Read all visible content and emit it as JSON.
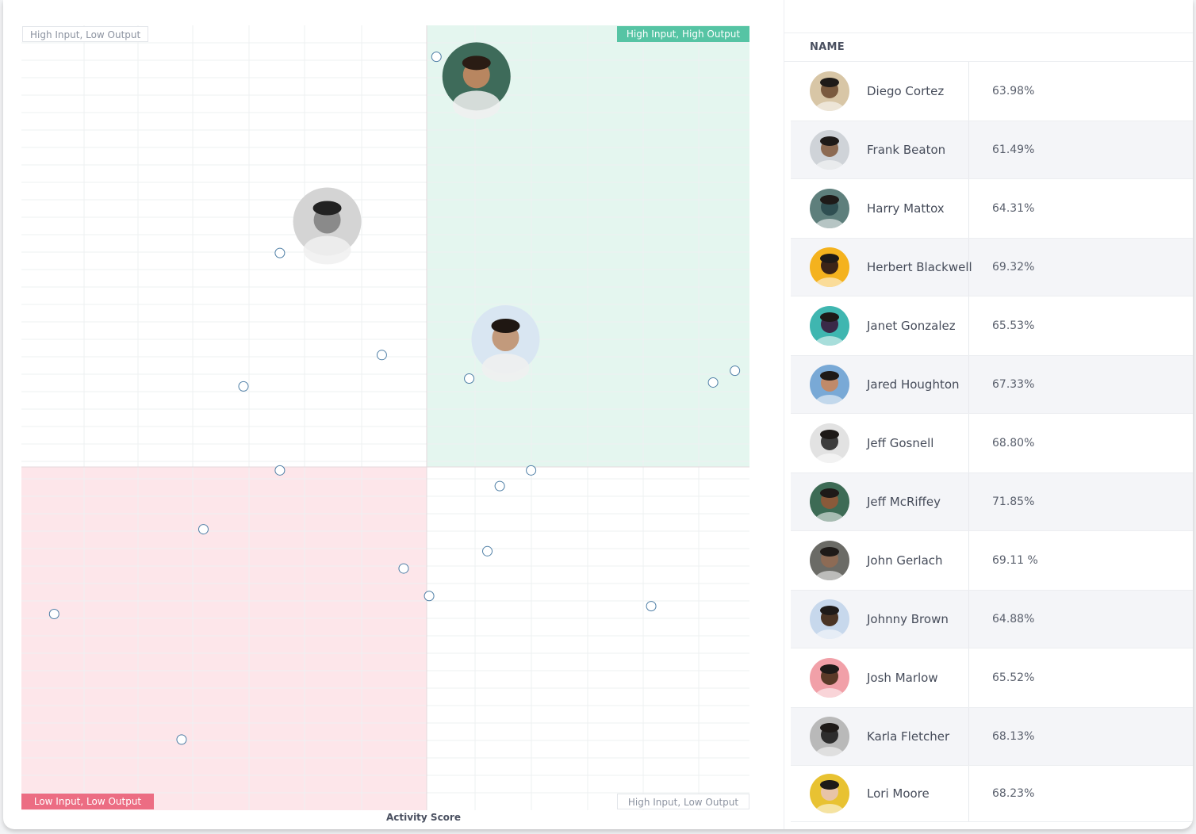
{
  "colors": {
    "teal_quadrant": "#e4f6ef",
    "pink_quadrant": "#fde6ea",
    "teal_label": "#56c4a4",
    "pink_label": "#ec6d83",
    "marker_stroke": "#4f7fa6"
  },
  "quadrant_labels": {
    "top_left": "High Input, Low Output",
    "top_right": "High Input, High Output",
    "bottom_left": "Low Input, Low Output",
    "bottom_right": "High Input, Low Output"
  },
  "chart_data": {
    "type": "scatter",
    "xlabel": "Activity Score",
    "ylabel": "",
    "xlim": [
      0,
      100
    ],
    "ylim": [
      0,
      100
    ],
    "grid": true,
    "quadrants": true,
    "points": [
      {
        "x": 57.0,
        "y": 96.0
      },
      {
        "x": 35.5,
        "y": 71.0
      },
      {
        "x": 49.5,
        "y": 58.0
      },
      {
        "x": 30.5,
        "y": 54.0
      },
      {
        "x": 61.5,
        "y": 55.0
      },
      {
        "x": 95.0,
        "y": 54.5
      },
      {
        "x": 98.0,
        "y": 56.0
      },
      {
        "x": 35.5,
        "y": 43.3
      },
      {
        "x": 70.0,
        "y": 43.3
      },
      {
        "x": 65.7,
        "y": 41.3
      },
      {
        "x": 25.0,
        "y": 35.8
      },
      {
        "x": 64.0,
        "y": 33.0
      },
      {
        "x": 52.5,
        "y": 30.8
      },
      {
        "x": 56.0,
        "y": 27.3
      },
      {
        "x": 4.5,
        "y": 25.0
      },
      {
        "x": 86.5,
        "y": 26.0
      },
      {
        "x": 22.0,
        "y": 9.0
      }
    ],
    "avatar_points": [
      {
        "x": 62.5,
        "y": 93.5,
        "avatar": "person-1"
      },
      {
        "x": 42.0,
        "y": 75.0,
        "avatar": "person-2"
      },
      {
        "x": 66.5,
        "y": 60.0,
        "avatar": "person-3"
      }
    ]
  },
  "table": {
    "column_header": "NAME",
    "rows": [
      {
        "name": "Diego Cortez",
        "value": "63.98%",
        "avatar_color": "#7a5a3e",
        "bg": "#d8c6a6"
      },
      {
        "name": "Frank Beaton",
        "value": "61.49%",
        "avatar_color": "#8c6a52",
        "bg": "#cfd3d8"
      },
      {
        "name": "Harry Mattox",
        "value": "64.31%",
        "avatar_color": "#2f4f52",
        "bg": "#5e7f7c"
      },
      {
        "name": "Herbert Blackwell",
        "value": "69.32%",
        "avatar_color": "#3b2418",
        "bg": "#f4b21e"
      },
      {
        "name": "Janet Gonzalez",
        "value": "65.53%",
        "avatar_color": "#3a2a48",
        "bg": "#3fb6b0"
      },
      {
        "name": "Jared Houghton",
        "value": "67.33%",
        "avatar_color": "#c08a6a",
        "bg": "#79a9d6"
      },
      {
        "name": "Jeff Gosnell",
        "value": "68.80%",
        "avatar_color": "#3d3d3d",
        "bg": "#e2e2e2"
      },
      {
        "name": "Jeff McRiffey",
        "value": "71.85%",
        "avatar_color": "#8a5a3a",
        "bg": "#3d6b55"
      },
      {
        "name": "John Gerlach",
        "value": "69.11 %",
        "avatar_color": "#8d6b55",
        "bg": "#6b6b66"
      },
      {
        "name": "Johnny Brown",
        "value": "64.88%",
        "avatar_color": "#4a3424",
        "bg": "#c7d8ec"
      },
      {
        "name": "Josh Marlow",
        "value": "65.52%",
        "avatar_color": "#5a3a28",
        "bg": "#f1a0a8"
      },
      {
        "name": "Karla Fletcher",
        "value": "68.13%",
        "avatar_color": "#2d2d2d",
        "bg": "#b9b9b9"
      },
      {
        "name": "Lori Moore",
        "value": "68.23%",
        "avatar_color": "#e8c4a8",
        "bg": "#e8c232"
      }
    ]
  }
}
